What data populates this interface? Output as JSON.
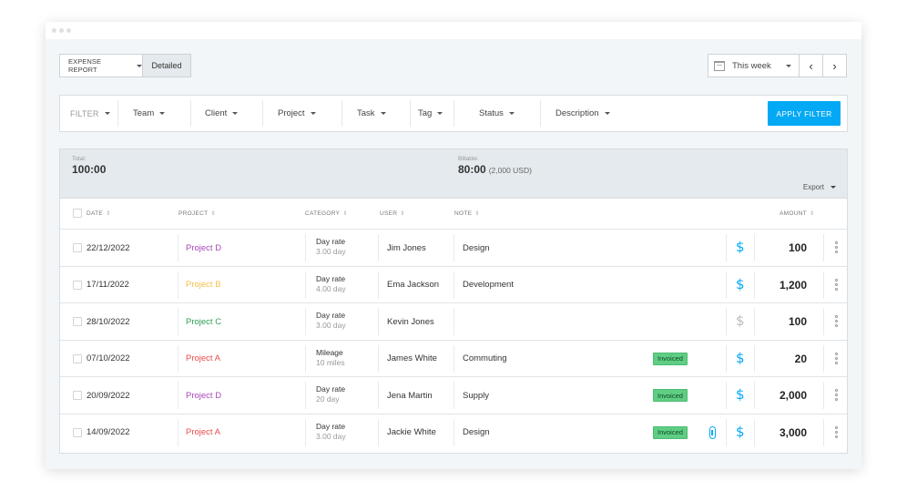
{
  "toolbar": {
    "report_label": "EXPENSE REPORT",
    "detailed_label": "Detailed",
    "date_range": "This week",
    "prev_label": "‹",
    "next_label": "›"
  },
  "filters": {
    "filter_label": "FILTER",
    "items": [
      "Team",
      "Client",
      "Project",
      "Task",
      "Tag",
      "Status",
      "Description"
    ],
    "apply_label": "APPLY FILTER"
  },
  "summary": {
    "total_label": "Total:",
    "total_value": "100:00",
    "billable_label": "Billable:",
    "billable_value": "80:00",
    "billable_amount": "(2,000 USD)",
    "export_label": "Export"
  },
  "table": {
    "headers": {
      "date": "DATE",
      "project": "PROJECT",
      "category": "CATEGORY",
      "user": "USER",
      "note": "NOTE",
      "amount": "AMOUNT",
      "sort_glyph": "⇕"
    },
    "rows": [
      {
        "date": "22/12/2022",
        "project": "Project D",
        "project_color": "#ab47bc",
        "category": "Day rate",
        "quantity": "3.00 day",
        "user": "Jim Jones",
        "note": "Design",
        "invoiced": "",
        "billable": true,
        "attachment": false,
        "amount": "100"
      },
      {
        "date": "17/11/2022",
        "project": "Project B",
        "project_color": "#f3c14b",
        "category": "Day rate",
        "quantity": "4.00 day",
        "user": "Ema Jackson",
        "note": "Development",
        "invoiced": "",
        "billable": true,
        "attachment": false,
        "amount": "1,200"
      },
      {
        "date": "28/10/2022",
        "project": "Project C",
        "project_color": "#2e9e57",
        "category": "Day rate",
        "quantity": "3.00 day",
        "user": "Kevin Jones",
        "note": "",
        "invoiced": "",
        "billable": false,
        "attachment": false,
        "amount": "100"
      },
      {
        "date": "07/10/2022",
        "project": "Project A",
        "project_color": "#e84d4d",
        "category": "Mileage",
        "quantity": "10 miles",
        "user": "James White",
        "note": "Commuting",
        "invoiced": "Invoiced",
        "billable": true,
        "attachment": false,
        "amount": "20"
      },
      {
        "date": "20/09/2022",
        "project": "Project D",
        "project_color": "#ab47bc",
        "category": "Day rate",
        "quantity": "20 day",
        "user": "Jena Martin",
        "note": "Supply",
        "invoiced": "Invoiced",
        "billable": true,
        "attachment": false,
        "amount": "2,000"
      },
      {
        "date": "14/09/2022",
        "project": "Project A",
        "project_color": "#e84d4d",
        "category": "Day rate",
        "quantity": "3.00 day",
        "user": "Jackie White",
        "note": "Design",
        "invoiced": "Invoiced",
        "billable": true,
        "attachment": true,
        "amount": "3,000"
      }
    ],
    "billable_symbol": "$"
  },
  "colors": {
    "accent": "#03a9f4",
    "invoiced_badge": "#5fce84"
  }
}
